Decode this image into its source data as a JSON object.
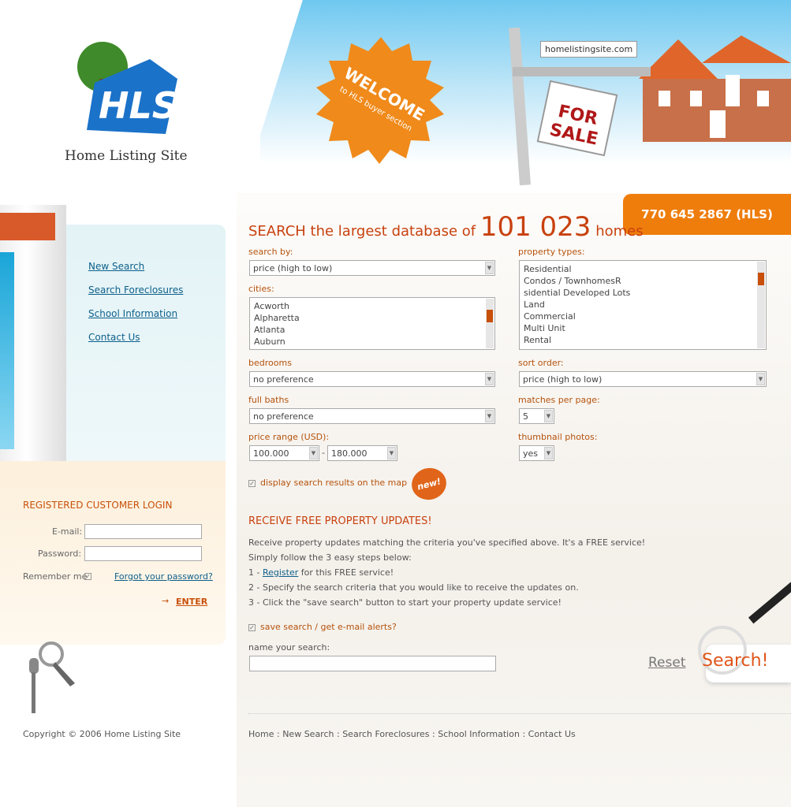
{
  "brand": {
    "name": "Home Listing Site",
    "logo_text": "HLS"
  },
  "header": {
    "welcome_line1": "WELCOME",
    "welcome_line2": "to HLS buyer section",
    "sign_url": "homelistingsite.com",
    "sign_text": "FOR SALE",
    "phone": "770 645 2867 (HLS)"
  },
  "nav": [
    {
      "label": "New Search"
    },
    {
      "label": "Search Foreclosures"
    },
    {
      "label": "School Information"
    },
    {
      "label": "Contact Us"
    }
  ],
  "login": {
    "title": "REGISTERED CUSTOMER LOGIN",
    "email_label": "E-mail:",
    "password_label": "Password:",
    "email_value": "",
    "password_value": "",
    "remember_label": "Remember me",
    "remember_checked": true,
    "forgot": "Forgot your password?",
    "enter": "ENTER"
  },
  "search": {
    "title_pre": "SEARCH the largest database of",
    "count": "101 023",
    "title_post": "homes",
    "search_by_label": "search by:",
    "search_by_value": "price (high to low)",
    "cities_label": "cities:",
    "cities": [
      "Acworth",
      "Alpharetta",
      "Atlanta",
      "Auburn"
    ],
    "property_types_label": "property types:",
    "property_types": [
      "Residential",
      "Condos / TownhomesR",
      "sidential Developed Lots",
      "Land",
      "Commercial",
      "Multi Unit",
      "Rental"
    ],
    "bedrooms_label": "bedrooms",
    "bedrooms_value": "no preference",
    "sort_order_label": "sort order:",
    "sort_order_value": "price (high to low)",
    "baths_label": "full baths",
    "baths_value": "no preference",
    "matches_label": "matches per page:",
    "matches_value": "5",
    "price_label": "price range (USD):",
    "price_min": "100.000",
    "price_sep": "-",
    "price_max": "180.000",
    "thumbs_label": "thumbnail photos:",
    "thumbs_value": "yes",
    "map_label": "display search results on the map",
    "new_badge": "new!"
  },
  "updates": {
    "title": "RECEIVE FREE PROPERTY UPDATES!",
    "line1": "Receive property updates matching the criteria you've specified above. It's a FREE service!",
    "line2": "Simply follow the 3 easy steps below:",
    "step1_pre": "1 - ",
    "step1_link": "Register",
    "step1_post": " for this FREE service!",
    "step2": "2 - Specify the search criteria that you would like to receive the updates on.",
    "step3": "3 - Click the \"save search\" button to start your property update service!",
    "save_label": "save search / get e-mail alerts?",
    "name_label": "name your search:",
    "name_value": "",
    "reset": "Reset",
    "search_btn": "Search!"
  },
  "footer": {
    "copyright": "Copyright © 2006 Home Listing Site",
    "links": [
      "Home",
      "New Search",
      "Search Foreclosures",
      "School Information",
      "Contact Us"
    ]
  },
  "colors": {
    "accent": "#ef7d0c",
    "heading": "#c8410f",
    "link": "#0d5f8a"
  }
}
